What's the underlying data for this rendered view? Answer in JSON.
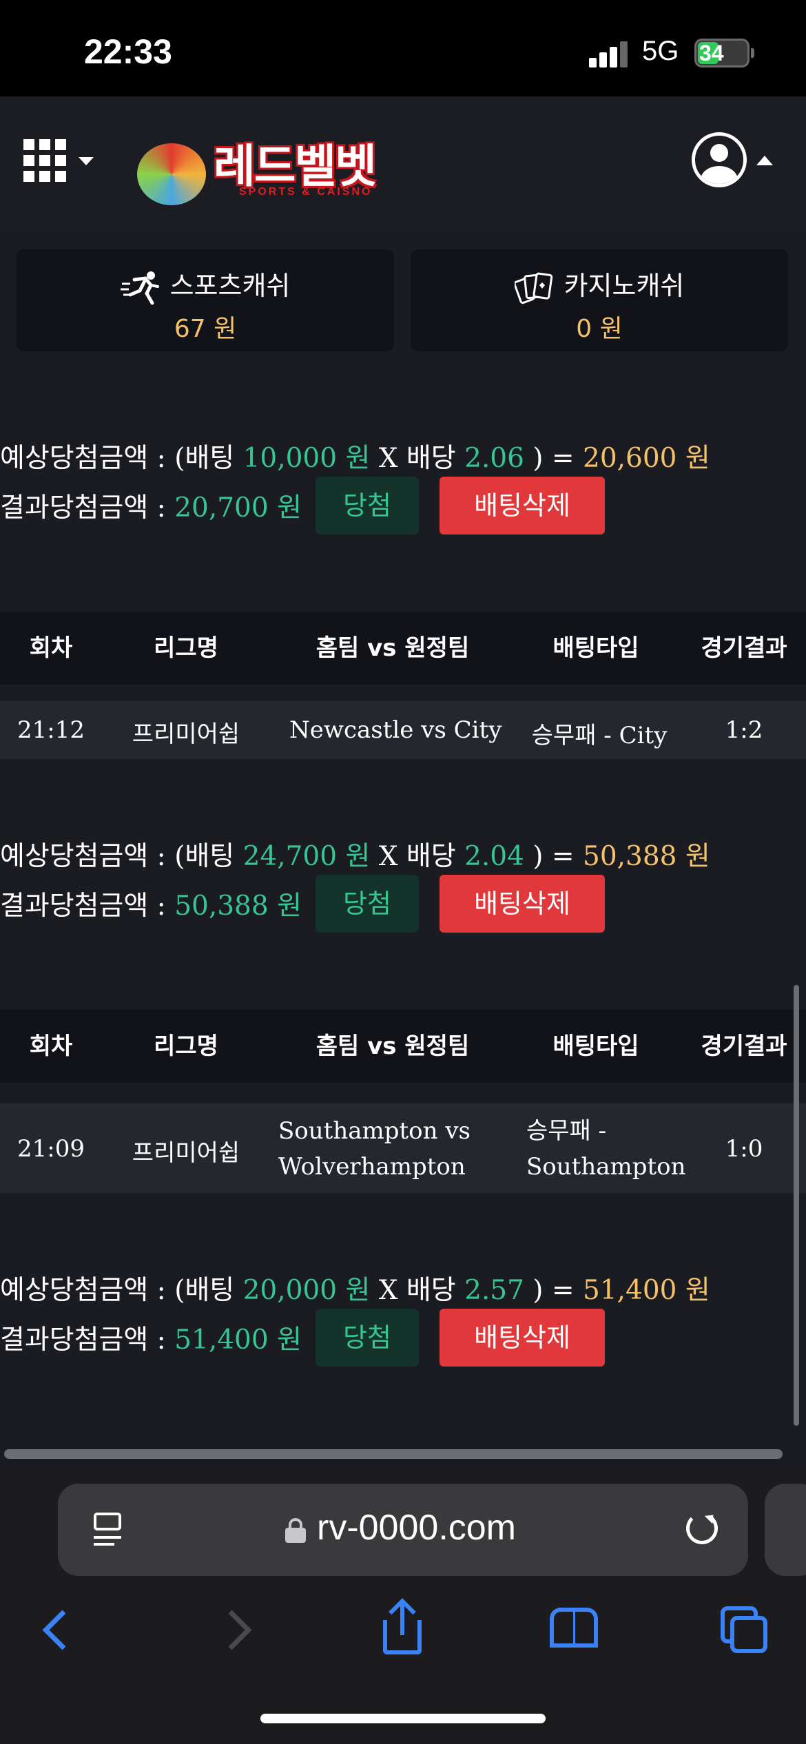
{
  "status": {
    "time": "22:33",
    "network": "5G",
    "battery": "34"
  },
  "header": {
    "logo_title": "레드벨벳",
    "logo_sub": "SPORTS & CAISNO"
  },
  "cash": {
    "sports_label": "스포츠캐쉬",
    "sports_value": "67 원",
    "casino_label": "카지노캐쉬",
    "casino_value": "0 원"
  },
  "labels": {
    "expected_prefix": "예상당첨금액 : (배팅 ",
    "times": " X 배당 ",
    "equals": " ) = ",
    "result_prefix": "결과당첨금액 : ",
    "won_badge": "당첨",
    "delete_button": "배팅삭제"
  },
  "table_headers": [
    "회차",
    "리그명",
    "홈팀 vs 원정팀",
    "배팅타입",
    "경기결과"
  ],
  "bets": [
    {
      "bet": "10,000 원",
      "odds": "2.06",
      "expected": "20,600 원",
      "result": "20,700 원"
    },
    {
      "bet": "24,700 원",
      "odds": "2.04",
      "expected": "50,388 원",
      "result": "50,388 원",
      "row": {
        "round": "21:12",
        "league": "프리미어쉽",
        "match": "Newcastle vs City",
        "type": "승무패 - City",
        "score": "1:2"
      }
    },
    {
      "bet": "20,000 원",
      "odds": "2.57",
      "expected": "51,400 원",
      "result": "51,400 원",
      "row": {
        "round": "21:09",
        "league": "프리미어쉽",
        "match": "Southampton vs Wolverhampton",
        "type": "승무패 - Southampton",
        "score": "1:0"
      }
    }
  ],
  "browser": {
    "url": "rv-0000.com"
  }
}
